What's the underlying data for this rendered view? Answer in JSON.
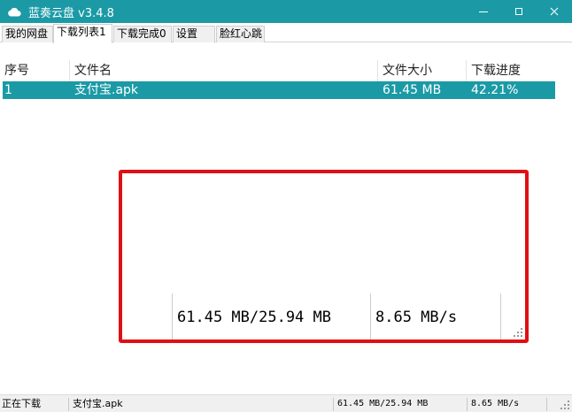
{
  "window": {
    "title": "蓝奏云盘 v3.4.8",
    "accent_color": "#1b9aa6",
    "icon": "cloud-icon",
    "controls": [
      "minimize-icon",
      "maximize-icon",
      "close-icon"
    ]
  },
  "tabs": [
    {
      "label": "我的网盘",
      "active": false
    },
    {
      "label": "下载列表1",
      "active": true
    },
    {
      "label": "下载完成0",
      "active": false
    },
    {
      "label": "设置",
      "active": false
    },
    {
      "label": "脸红心跳",
      "active": false
    }
  ],
  "table": {
    "headers": {
      "index": "序号",
      "filename": "文件名",
      "size": "文件大小",
      "progress": "下载进度"
    },
    "rows": [
      {
        "index": "1",
        "filename": "支付宝.apk",
        "size": "61.45 MB",
        "progress": "42.21%",
        "selected": true
      }
    ]
  },
  "highlight": {
    "border_color": "#e00f16",
    "progress_text": "61.45 MB/25.94 MB",
    "speed_text": "8.65 MB/s"
  },
  "statusbar": {
    "state": "正在下载",
    "filename": "支付宝.apk",
    "progress_text": "61.45 MB/25.94 MB",
    "speed_text": "8.65 MB/s"
  }
}
